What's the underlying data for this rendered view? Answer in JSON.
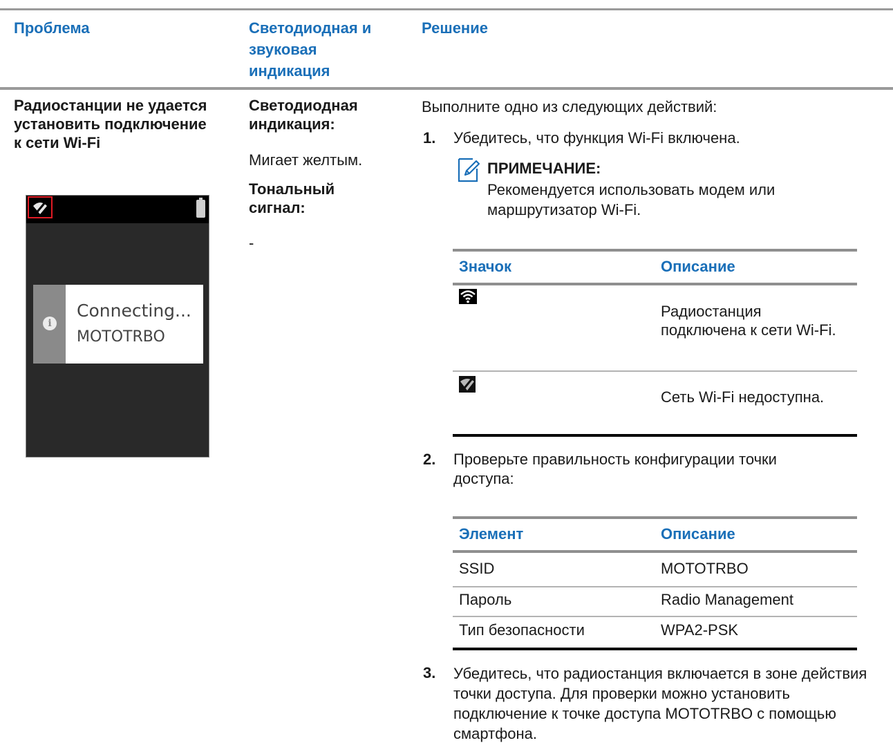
{
  "table": {
    "headers": {
      "problem": "Проблема",
      "indication": "Светодиодная и звуковая индикация",
      "solution": "Решение"
    },
    "problem_text": "Радиостанции не удается установить подключение к сети Wi-Fi",
    "indication": {
      "led_label": "Светодиодная индикация:",
      "led_value": "Мигает желтым.",
      "tone_label": "Тональный сигнал:",
      "tone_value": "-"
    }
  },
  "phone_screen": {
    "dialog_line1": "Connecting...",
    "dialog_line2": "MOTOTRBO",
    "status_icons": [
      "wifi-disconnected-icon",
      "battery-icon"
    ],
    "info_glyph": "i"
  },
  "solution": {
    "intro": "Выполните одно из следующих действий:",
    "steps": [
      {
        "num": "1.",
        "text": "Убедитесь, что функция Wi-Fi включена."
      },
      {
        "num": "2.",
        "text": "Проверьте правильность конфигурации точки доступа:"
      },
      {
        "num": "3.",
        "text": "Убедитесь, что радиостанция включается в зоне действия точки доступа. Для проверки можно установить подключение к точке доступа MOTOTRBO с помощью смартфона."
      }
    ],
    "note": {
      "title": "ПРИМЕЧАНИЕ:",
      "text": "Рекомендуется использовать модем или маршрутизатор Wi-Fi."
    },
    "icon_table": {
      "headers": [
        "Значок",
        "Описание"
      ],
      "rows": [
        {
          "icon": "wifi-connected-icon",
          "desc": "Радиостанция подключена к сети Wi-Fi."
        },
        {
          "icon": "wifi-unavailable-icon",
          "desc": "Сеть Wi-Fi недоступна."
        }
      ]
    },
    "config_table": {
      "headers": [
        "Элемент",
        "Описание"
      ],
      "rows": [
        [
          "SSID",
          "MOTOTRBO"
        ],
        [
          "Пароль",
          "Radio Management"
        ],
        [
          "Тип безопасности",
          "WPA2-PSK"
        ]
      ]
    }
  }
}
